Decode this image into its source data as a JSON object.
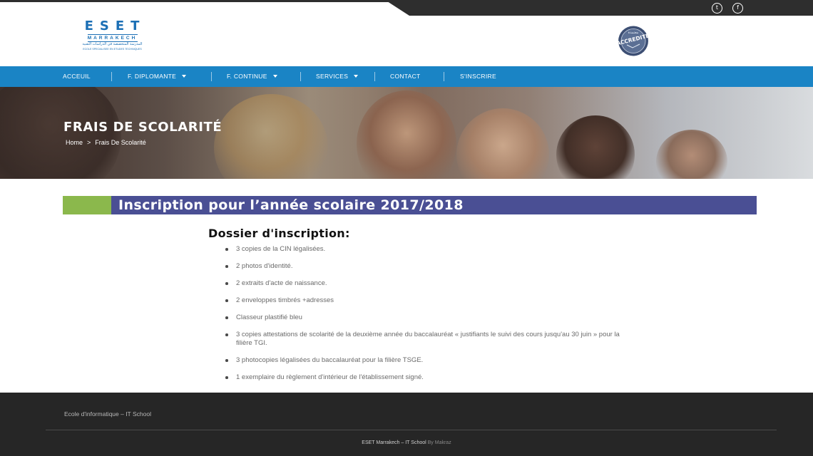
{
  "social": {
    "twitter_glyph": "t",
    "facebook_glyph": "f"
  },
  "logo": {
    "line1": "ESET",
    "line2": "MARRAKECH",
    "line3": "المدرسة المتخصصة في الدراسات التقنية",
    "line4": "ECOLE SPECIALISEE EN ETUDES TECHNIQUES"
  },
  "badge": {
    "text": "ACCREDITE",
    "arabic": "معتمدة"
  },
  "nav": {
    "items": [
      {
        "label": "ACCEUIL"
      },
      {
        "label": "F. DIPLOMANTE"
      },
      {
        "label": "F. CONTINUE"
      },
      {
        "label": "SERVICES"
      },
      {
        "label": "CONTACT"
      },
      {
        "label": "S'INSCRIRE"
      }
    ]
  },
  "hero": {
    "title": "FRAIS DE SCOLARITÉ",
    "breadcrumb_home": "Home",
    "breadcrumb_sep": ">",
    "breadcrumb_current": "Frais De Scolarité"
  },
  "section": {
    "title": "Inscription pour l’année scolaire 2017/2018"
  },
  "dossier": {
    "title": "Dossier d'inscription:",
    "items": [
      "3 copies de la CIN légalisées.",
      "2 photos d'identité.",
      "2 extraits d'acte de naissance.",
      "2 enveloppes timbrés +adresses",
      "Classeur plastifié bleu",
      "3 copies attestations de scolarité de la deuxième année du baccalauréat « justifiants le suivi des cours jusqu'au 30 juin » pour la filière TGI.",
      "3 photocopies légalisées du baccalauréat pour la filière TSGE.",
      "1 exemplaire du règlement d'intérieur de l'établissement signé."
    ]
  },
  "footer": {
    "school": "Ecole d'informatique – IT School",
    "copyright_main": "ESET Marrakech – IT School",
    "copyright_by": "By Makraz"
  },
  "colors": {
    "nav_bg": "#1a84c5",
    "section_bar": "#4a4f94",
    "section_accent": "#8bb84c",
    "footer_bg": "#262626",
    "logo_blue": "#1b6fb5"
  }
}
